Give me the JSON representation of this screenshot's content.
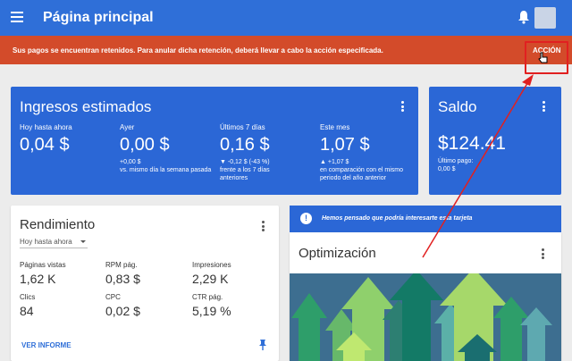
{
  "topbar": {
    "title": "Página principal",
    "menu_icon": "menu-icon",
    "bell_icon": "bell-icon"
  },
  "alert": {
    "message": "Sus pagos se encuentran retenidos. Para anular dicha retención, deberá llevar a cabo la acción especificada.",
    "action_label": "ACCIÓN",
    "color": "#d34b2a"
  },
  "ingresos": {
    "title": "Ingresos estimados",
    "metrics": [
      {
        "label": "Hoy hasta ahora",
        "value": "0,04 $",
        "sub1": "",
        "sub2": ""
      },
      {
        "label": "Ayer",
        "value": "0,00 $",
        "sub1": "+0,00 $",
        "sub2": "vs. mismo día la semana pasada"
      },
      {
        "label": "Últimos 7 días",
        "value": "0,16 $",
        "sub1": "▼ -0,12 $ (-43 %)",
        "sub2": "frente a los 7 días anteriores"
      },
      {
        "label": "Este mes",
        "value": "1,07 $",
        "sub1": "▲ +1,07 $",
        "sub2": "en comparación con el mismo periodo del año anterior"
      }
    ]
  },
  "saldo": {
    "title": "Saldo",
    "value": "$124.41",
    "sub1": "Último pago:",
    "sub2": "0,00 $"
  },
  "rendimiento": {
    "title": "Rendimiento",
    "range": "Hoy hasta ahora",
    "metrics": [
      {
        "label": "Páginas vistas",
        "value": "1,62 K"
      },
      {
        "label": "RPM pág.",
        "value": "0,83 $"
      },
      {
        "label": "Impresiones",
        "value": "2,29 K"
      },
      {
        "label": "Clics",
        "value": "84"
      },
      {
        "label": "CPC",
        "value": "0,02 $"
      },
      {
        "label": "CTR pág.",
        "value": "5,19 %"
      }
    ],
    "link": "VER INFORME"
  },
  "promo": {
    "text": "Hemos pensado que podría interesarte esta tarjeta"
  },
  "optimizacion": {
    "title": "Optimización"
  },
  "colors": {
    "primary": "#2b67d6",
    "header": "#2f6fd8",
    "annotation": "#e12020"
  }
}
